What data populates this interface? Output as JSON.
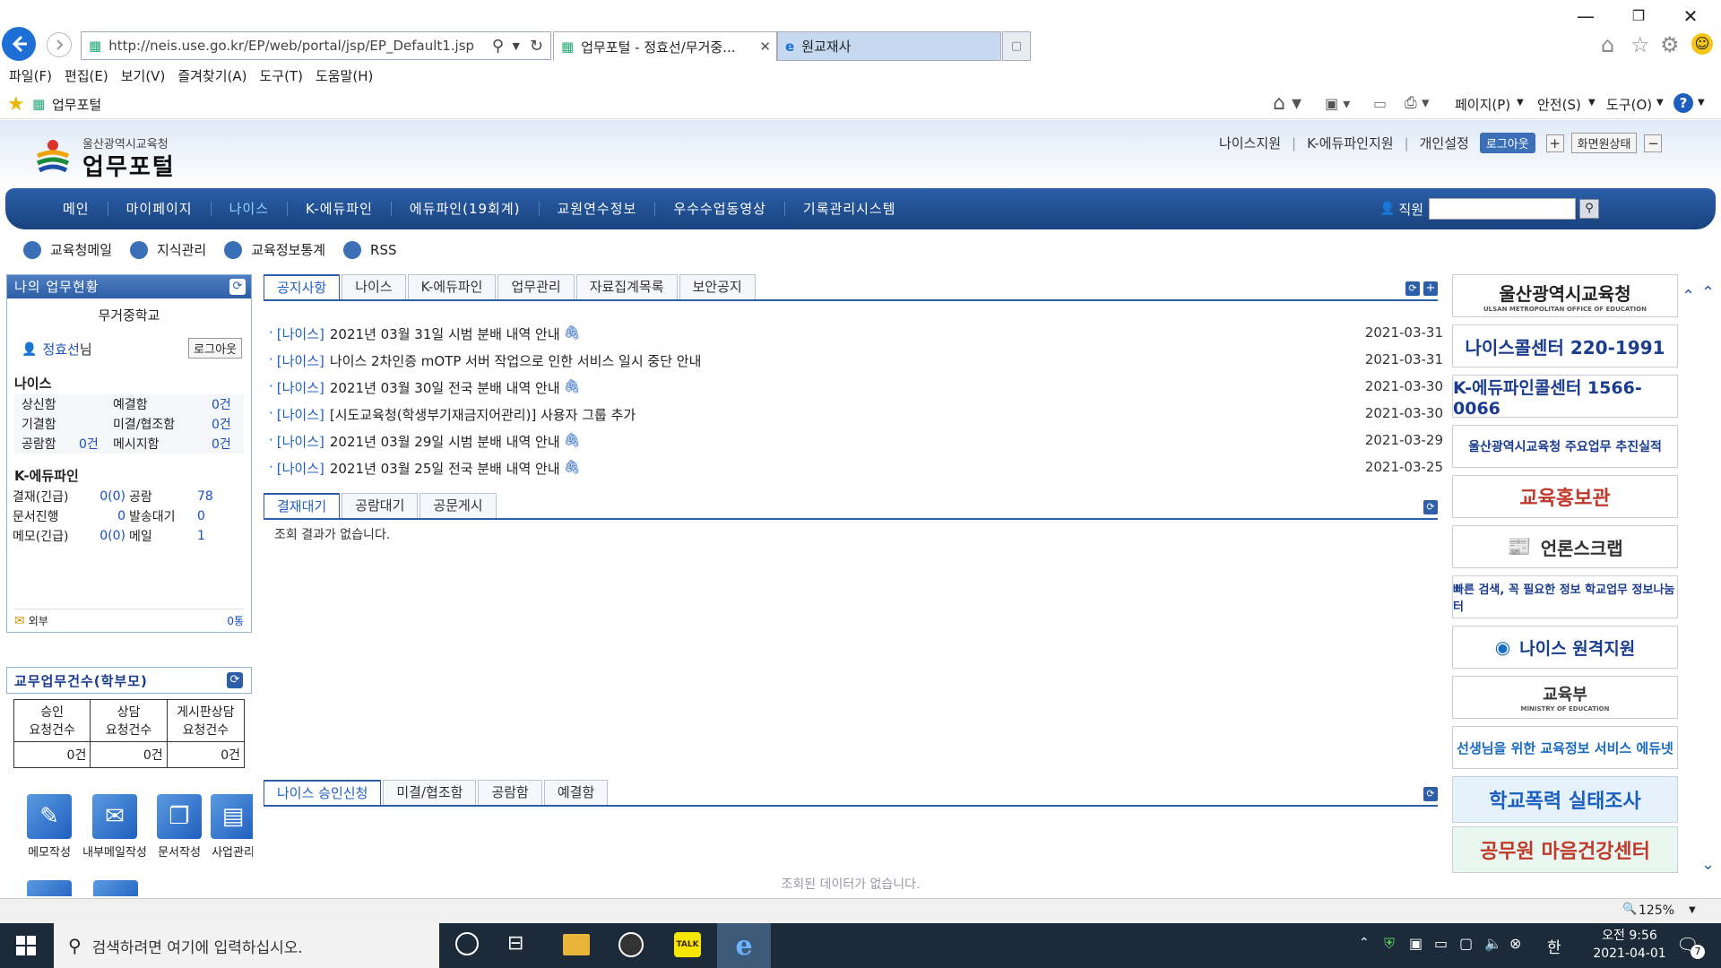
{
  "browser": {
    "address": "http://neis.use.go.kr/EP/web/portal/jsp/EP_Default1.jsp",
    "tabs": [
      {
        "label": "업무포털 - 정효선/무거중..."
      },
      {
        "label": "원교재사"
      }
    ],
    "menu": [
      "파일(F)",
      "편집(E)",
      "보기(V)",
      "즐겨찾기(A)",
      "도구(T)",
      "도움말(H)"
    ],
    "favorites_label": "업무포털",
    "commands": [
      "페이지(P)",
      "안전(S)",
      "도구(O)"
    ],
    "zoom": "125%"
  },
  "header": {
    "org": "울산광역시교육청",
    "portal": "업무포털",
    "links": [
      "나이스지원",
      "K-에듀파인지원",
      "개인설정"
    ],
    "logout": "로그아웃",
    "reset": "화면원상태"
  },
  "gnb": {
    "items": [
      "메인",
      "마이페이지",
      "나이스",
      "K-에듀파인",
      "에듀파인(19회계)",
      "교원연수정보",
      "우수수업동영상",
      "기록관리시스템"
    ],
    "search_label": "직원"
  },
  "quicklinks": [
    "교육청메일",
    "지식관리",
    "교육정보통계",
    "RSS"
  ],
  "mywork": {
    "title": "나의 업무현황",
    "school": "무거중학교",
    "user": "정효선",
    "user_suffix": "님",
    "logout": "로그아웃",
    "neis_title": "나이스",
    "neis_rows": [
      {
        "l1": "상신함",
        "v1": "",
        "l2": "예결함",
        "v2": "0건"
      },
      {
        "l1": "기결함",
        "v1": "",
        "l2": "미결/협조함",
        "v2": "0건"
      },
      {
        "l1": "공람함",
        "v1": "0건",
        "l2": "메시지함",
        "v2": "0건"
      }
    ],
    "edufine_title": "K-에듀파인",
    "edufine_rows": [
      {
        "l1": "결재(긴급)",
        "v1": "0(0)",
        "l2": "공람",
        "v2": "78"
      },
      {
        "l1": "문서진행",
        "v1": "0",
        "l2": "발송대기",
        "v2": "0"
      },
      {
        "l1": "메모(긴급)",
        "v1": "0(0)",
        "l2": "메일",
        "v2": "1"
      }
    ],
    "mail_label": "외부",
    "mail_count": "0통"
  },
  "parent": {
    "title": "교무업무건수(학부모)",
    "headers": [
      "승인\n요청건수",
      "상담\n요청건수",
      "게시판상담\n요청건수"
    ],
    "values": [
      "0건",
      "0건",
      "0건"
    ]
  },
  "shortcuts": [
    "메모작성",
    "내부메일작성",
    "문서작성",
    "사업관리"
  ],
  "notice": {
    "tabs": [
      "공지사항",
      "나이스",
      "K-에듀파인",
      "업무관리",
      "자료집계목록",
      "보안공지"
    ],
    "items": [
      {
        "cat": "[나이스]",
        "text": "2021년 03월 31일 시범 분배 내역 안내",
        "date": "2021-03-31",
        "clip": true
      },
      {
        "cat": "[나이스]",
        "text": "나이스 2차인증 mOTP 서버 작업으로 인한 서비스 일시 중단 안내",
        "date": "2021-03-31",
        "clip": false
      },
      {
        "cat": "[나이스]",
        "text": "2021년 03월 30일 전국 분배 내역 안내",
        "date": "2021-03-30",
        "clip": true
      },
      {
        "cat": "[나이스]",
        "text": "[시도교육청(학생부기재금지어관리)] 사용자 그룹 추가",
        "date": "2021-03-30",
        "clip": false
      },
      {
        "cat": "[나이스]",
        "text": "2021년 03월 29일 시범 분배 내역 안내",
        "date": "2021-03-29",
        "clip": true
      },
      {
        "cat": "[나이스]",
        "text": "2021년 03월 25일 전국 분배 내역 안내",
        "date": "2021-03-25",
        "clip": true
      }
    ]
  },
  "approval": {
    "tabs": [
      "결재대기",
      "공람대기",
      "공문게시"
    ],
    "empty": "조회 결과가 없습니다."
  },
  "neis_approval": {
    "tabs": [
      "나이스 승인신청",
      "미결/협조함",
      "공람함",
      "예결함"
    ],
    "empty": "조회된 데이터가 없습니다."
  },
  "banners": [
    {
      "text": "울산광역시교육청",
      "sub": "ULSAN METROPOLITAN OFFICE OF EDUCATION",
      "color": "#222"
    },
    {
      "text": "나이스콜센터 220-1991",
      "color": "#1a3d8f"
    },
    {
      "text": "K-에듀파인콜센터 1566-0066",
      "color": "#1a3d8f"
    },
    {
      "text": "울산광역시교육청 주요업무 추진실적",
      "color": "#1a3d8f"
    },
    {
      "text": "교육홍보관",
      "color": "#c0392b"
    },
    {
      "text": "언론스크랩",
      "color": "#333"
    },
    {
      "text": "빠른 검색, 꼭 필요한 정보 학교업무 정보나눔터",
      "color": "#1a3d8f"
    },
    {
      "text": "나이스 원격지원",
      "color": "#1a3d8f"
    },
    {
      "text": "교육부",
      "sub": "MINISTRY OF EDUCATION",
      "color": "#333"
    },
    {
      "text": "선생님을 위한 교육정보 서비스 에듀넷",
      "color": "#1a6cc0"
    },
    {
      "text": "학교폭력 실태조사",
      "color": "#1a5fbf"
    },
    {
      "text": "공무원 마음건강센터",
      "color": "#c0392b"
    }
  ],
  "taskbar": {
    "search_placeholder": "검색하려면 여기에 입력하십시오.",
    "ime": "한",
    "time": "오전 9:56",
    "date": "2021-04-01",
    "notif": "7"
  }
}
